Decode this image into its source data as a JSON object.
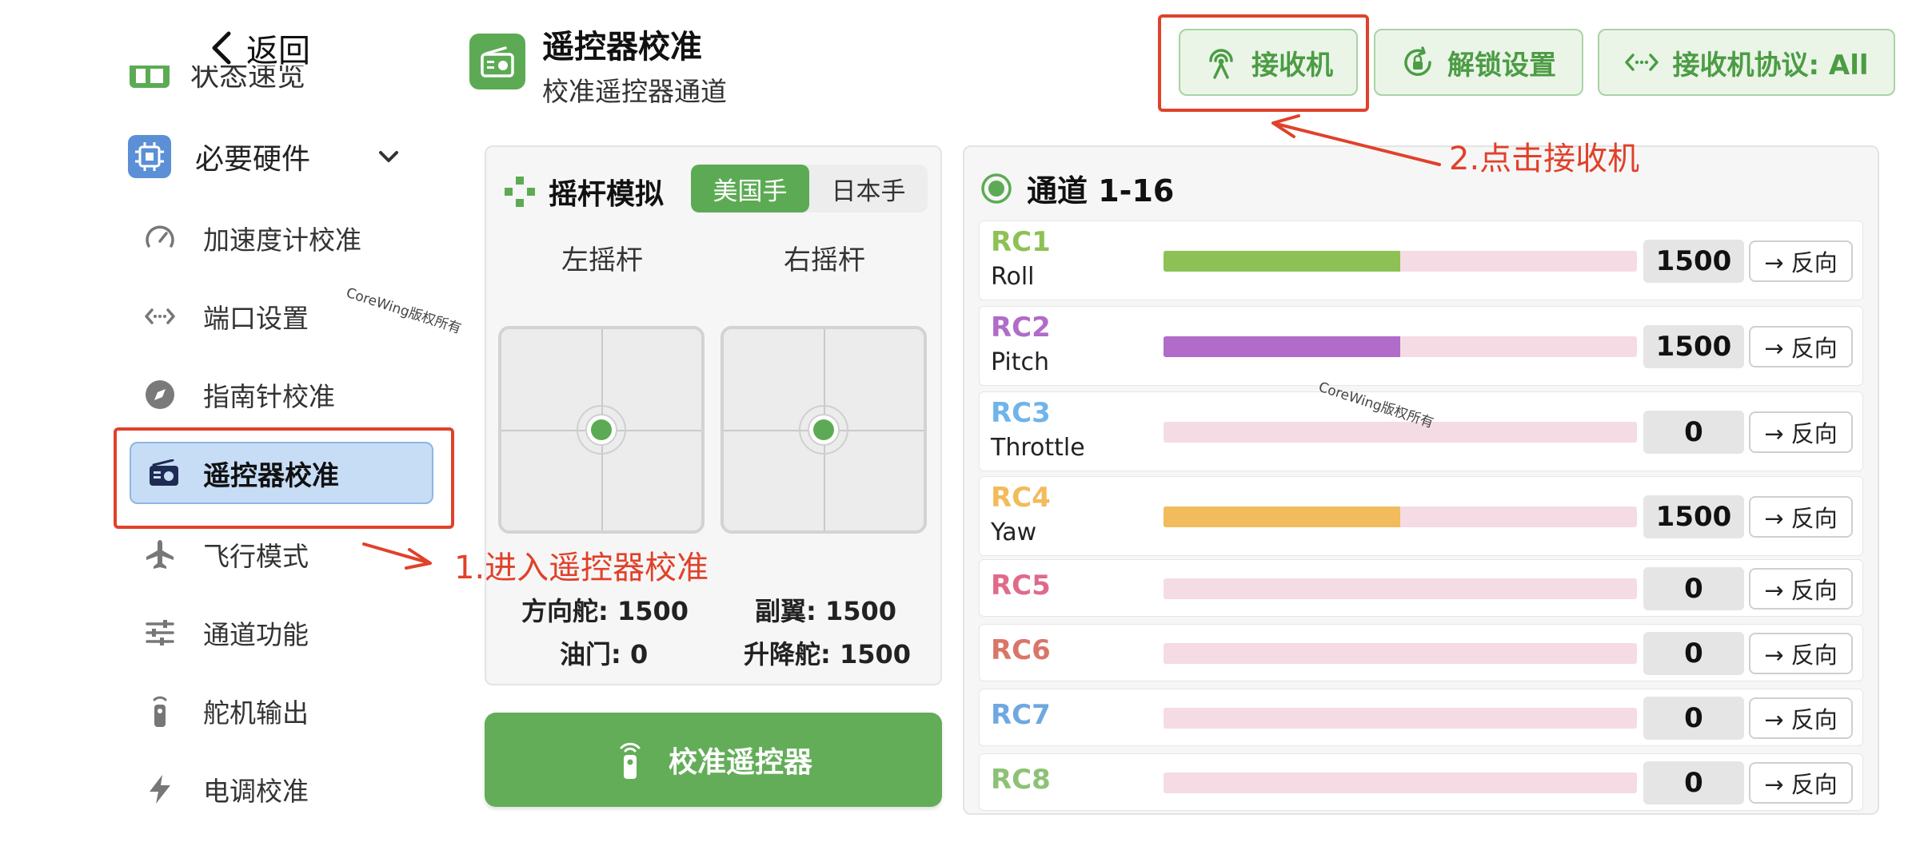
{
  "sidebar": {
    "back_label": "返回",
    "status_label": "状态速览",
    "group_label": "必要硬件",
    "items": [
      {
        "label": "加速度计校准",
        "icon": "gauge-icon"
      },
      {
        "label": "端口设置",
        "icon": "port-icon"
      },
      {
        "label": "指南针校准",
        "icon": "compass-icon"
      },
      {
        "label": "遥控器校准",
        "icon": "radio-icon",
        "active": true
      },
      {
        "label": "飞行模式",
        "icon": "airplane-icon"
      },
      {
        "label": "通道功能",
        "icon": "sliders-icon"
      },
      {
        "label": "舵机输出",
        "icon": "remote-icon"
      },
      {
        "label": "电调校准",
        "icon": "bolt-icon"
      }
    ]
  },
  "header": {
    "title": "遥控器校准",
    "subtitle": "校准遥控器通道",
    "buttons": {
      "receiver": "接收机",
      "unlock": "解锁设置",
      "protocol": "接收机协议: All"
    }
  },
  "sticks": {
    "title": "摇杆模拟",
    "modes": [
      "美国手",
      "日本手"
    ],
    "active_mode": "美国手",
    "left_label": "左摇杆",
    "right_label": "右摇杆",
    "rudder": "方向舵: 1500",
    "aileron": "副翼: 1500",
    "throttle": "油门: 0",
    "elevator": "升降舵: 1500",
    "calibrate_button": "校准遥控器"
  },
  "channels": {
    "title": "通道 1-16",
    "reverse_label": "→ 反向",
    "rows": [
      {
        "name": "RC1",
        "sub": "Roll",
        "value": "1500",
        "fill": 0.5,
        "color": "#8dc155"
      },
      {
        "name": "RC2",
        "sub": "Pitch",
        "value": "1500",
        "fill": 0.5,
        "color": "#b06cc8"
      },
      {
        "name": "RC3",
        "sub": "Throttle",
        "value": "0",
        "fill": 0,
        "color": "#6fb4ea"
      },
      {
        "name": "RC4",
        "sub": "Yaw",
        "value": "1500",
        "fill": 0.5,
        "color": "#f2bb5c"
      },
      {
        "name": "RC5",
        "sub": "",
        "value": "0",
        "fill": 0,
        "color": "#e06a8a"
      },
      {
        "name": "RC6",
        "sub": "",
        "value": "0",
        "fill": 0,
        "color": "#d9766a"
      },
      {
        "name": "RC7",
        "sub": "",
        "value": "0",
        "fill": 0,
        "color": "#6fa8e0"
      },
      {
        "name": "RC8",
        "sub": "",
        "value": "0",
        "fill": 0,
        "color": "#8dc177"
      }
    ]
  },
  "annotations": {
    "step1": "1.进入遥控器校准",
    "step2": "2.点击接收机",
    "watermark": "CoreWing版权所有"
  },
  "colors": {
    "accent_green": "#5cab54",
    "annotation_red": "#e0412a",
    "active_nav": "#c7ddf6"
  }
}
